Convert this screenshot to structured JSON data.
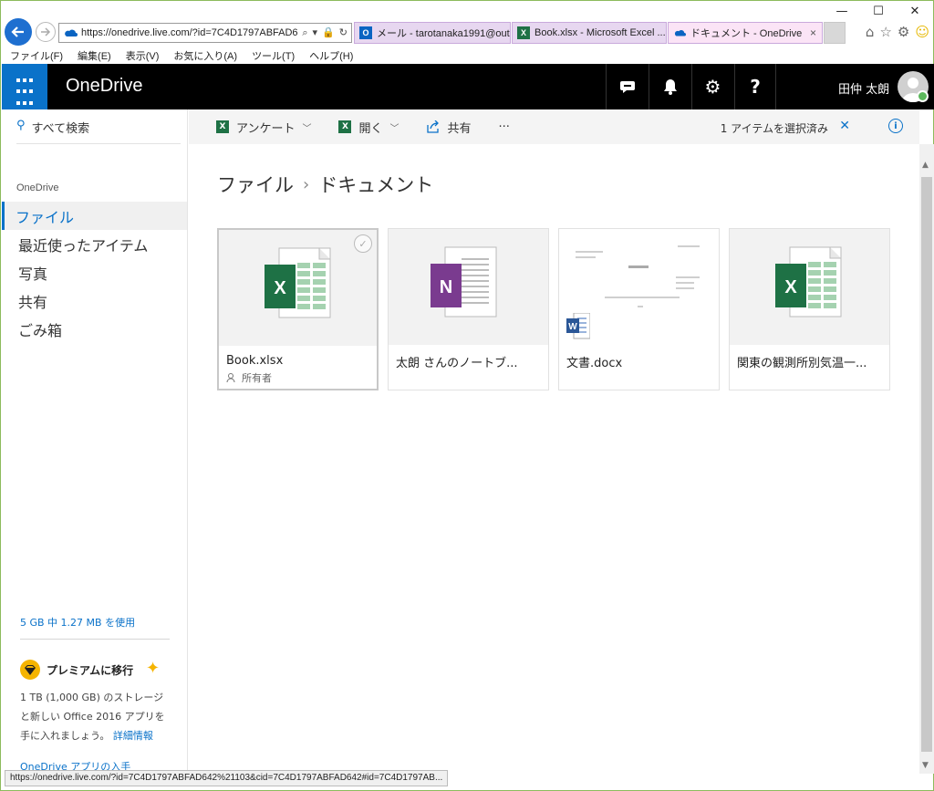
{
  "browser": {
    "url": "https://onedrive.live.com/?id=7C4D1797ABFAD6",
    "tabs": [
      {
        "title": "メール - tarotanaka1991@outl..."
      },
      {
        "title": "Book.xlsx - Microsoft Excel ..."
      },
      {
        "title": "ドキュメント - OneDrive"
      }
    ],
    "menu": [
      "ファイル(F)",
      "編集(E)",
      "表示(V)",
      "お気に入り(A)",
      "ツール(T)",
      "ヘルプ(H)"
    ],
    "status_url": "https://onedrive.live.com/?id=7C4D1797ABFAD642%21103&cid=7C4D1797ABFAD642#id=7C4D1797AB..."
  },
  "suite": {
    "brand": "OneDrive",
    "user_name": "田仲 太朗"
  },
  "nav": {
    "search_label": "すべて検索",
    "heading": "OneDrive",
    "items": [
      {
        "label": "ファイル",
        "active": true
      },
      {
        "label": "最近使ったアイテム"
      },
      {
        "label": "写真"
      },
      {
        "label": "共有"
      },
      {
        "label": "ごみ箱"
      }
    ],
    "usage": "5 GB 中 1.27 MB を使用",
    "premium_title": "プレミアムに移行",
    "premium_desc_1": "1 TB (1,000 GB) のストレージ",
    "premium_desc_2": "と新しい Office 2016 アプリを",
    "premium_desc_3": "手に入れましょう。",
    "premium_link": "詳細情報",
    "app_link": "OneDrive アプリの入手"
  },
  "commands": {
    "survey": "アンケート",
    "open": "開く",
    "share": "共有",
    "more": "···",
    "selected": "1 アイテムを選択済み"
  },
  "breadcrumb": {
    "root": "ファイル",
    "current": "ドキュメント"
  },
  "files": [
    {
      "name": "Book.xlsx",
      "owner": "所有者",
      "selected": true
    },
    {
      "name": "太朗 さんのノートブ..."
    },
    {
      "name": "文書.docx"
    },
    {
      "name": "関東の観測所別気温一..."
    }
  ],
  "colors": {
    "accent": "#0a72c9",
    "excel": "#1e7145",
    "onenote": "#7a3b8f",
    "word": "#2b5797",
    "suitebar": "#000000"
  }
}
